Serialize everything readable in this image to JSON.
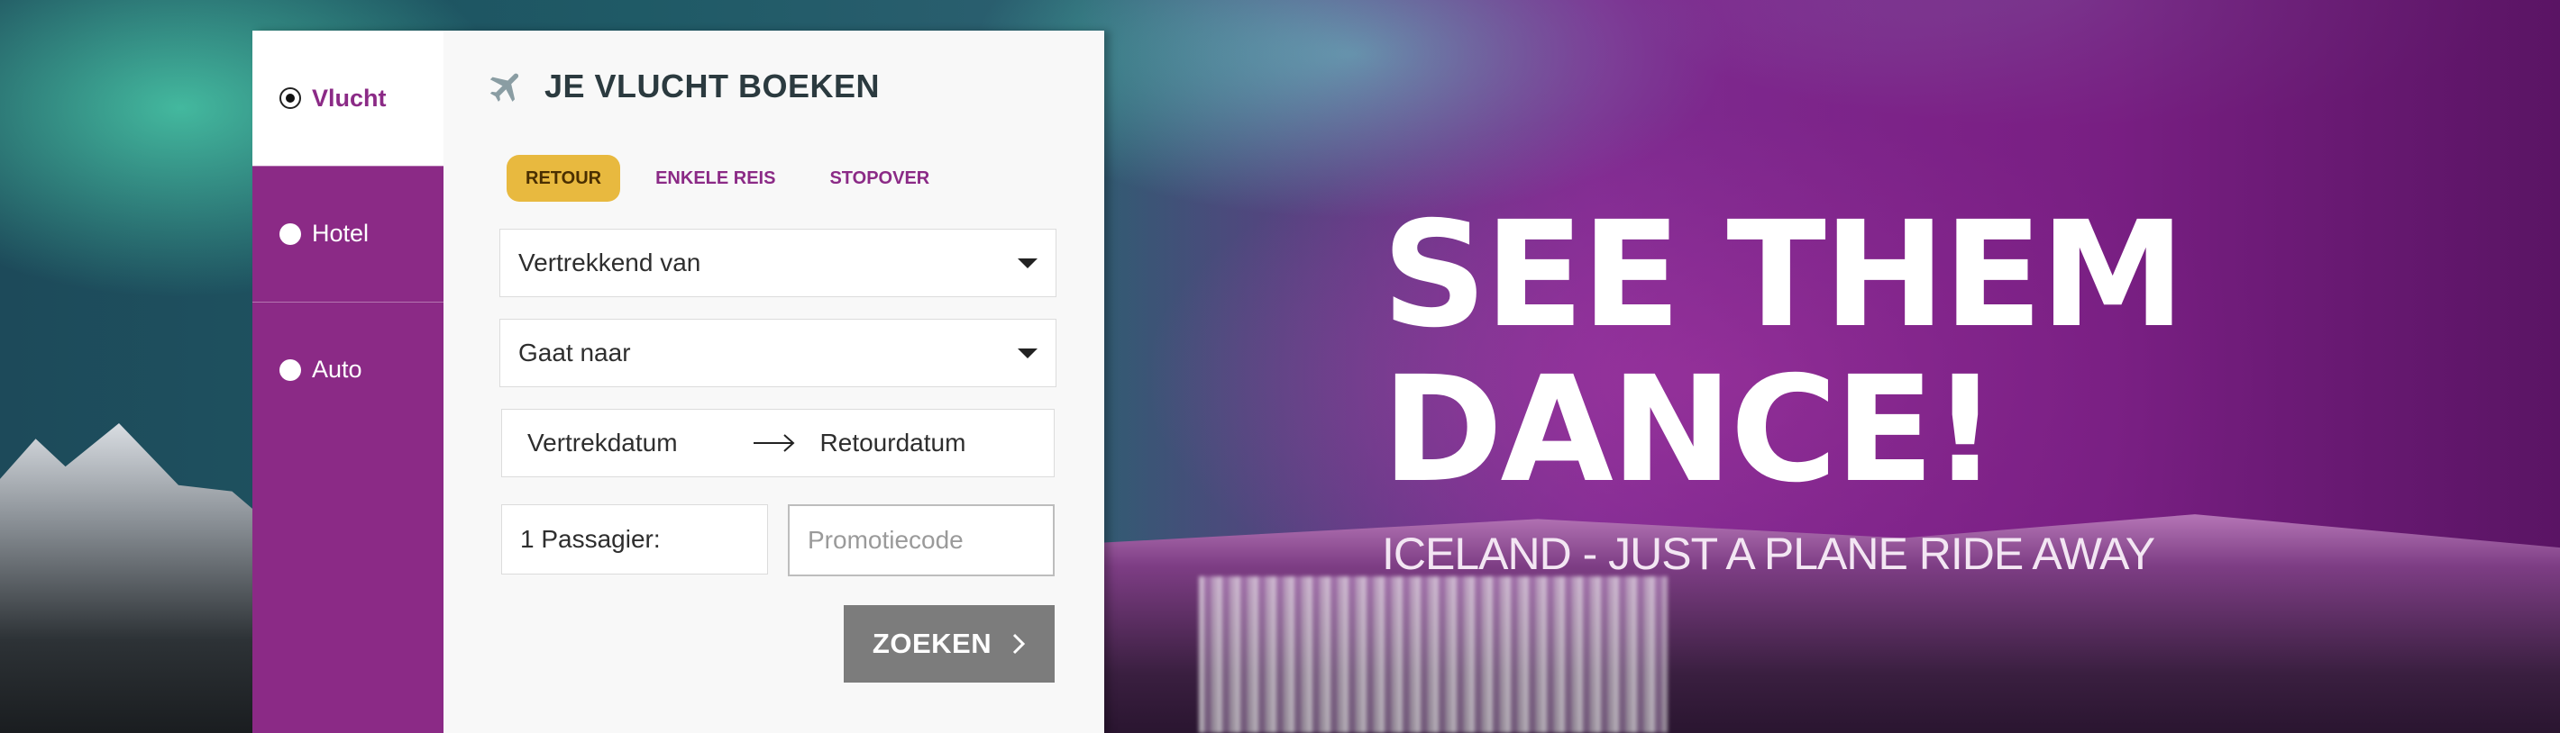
{
  "side_nav": {
    "items": [
      {
        "label": "Vlucht",
        "selected": true
      },
      {
        "label": "Hotel",
        "selected": false
      },
      {
        "label": "Auto",
        "selected": false
      }
    ]
  },
  "booking": {
    "icon": "airplane-icon",
    "title": "JE VLUCHT BOEKEN",
    "trip_types": [
      {
        "label": "RETOUR",
        "active": true
      },
      {
        "label": "ENKELE REIS",
        "active": false
      },
      {
        "label": "STOPOVER",
        "active": false
      }
    ],
    "from_label": "Vertrekkend van",
    "to_label": "Gaat naar",
    "departure_label": "Vertrekdatum",
    "return_label": "Retourdatum",
    "passengers_label": "1 Passagier:",
    "promo_placeholder": "Promotiecode",
    "search_label": "ZOEKEN"
  },
  "hero": {
    "headline_line1": "SEE THEM",
    "headline_line2": "DANCE!",
    "tagline": "ICELAND - JUST A PLANE RIDE AWAY"
  },
  "colors": {
    "brand_purple": "#8b2a86",
    "accent_yellow": "#e8b93f",
    "search_button": "#7c7c7c"
  }
}
